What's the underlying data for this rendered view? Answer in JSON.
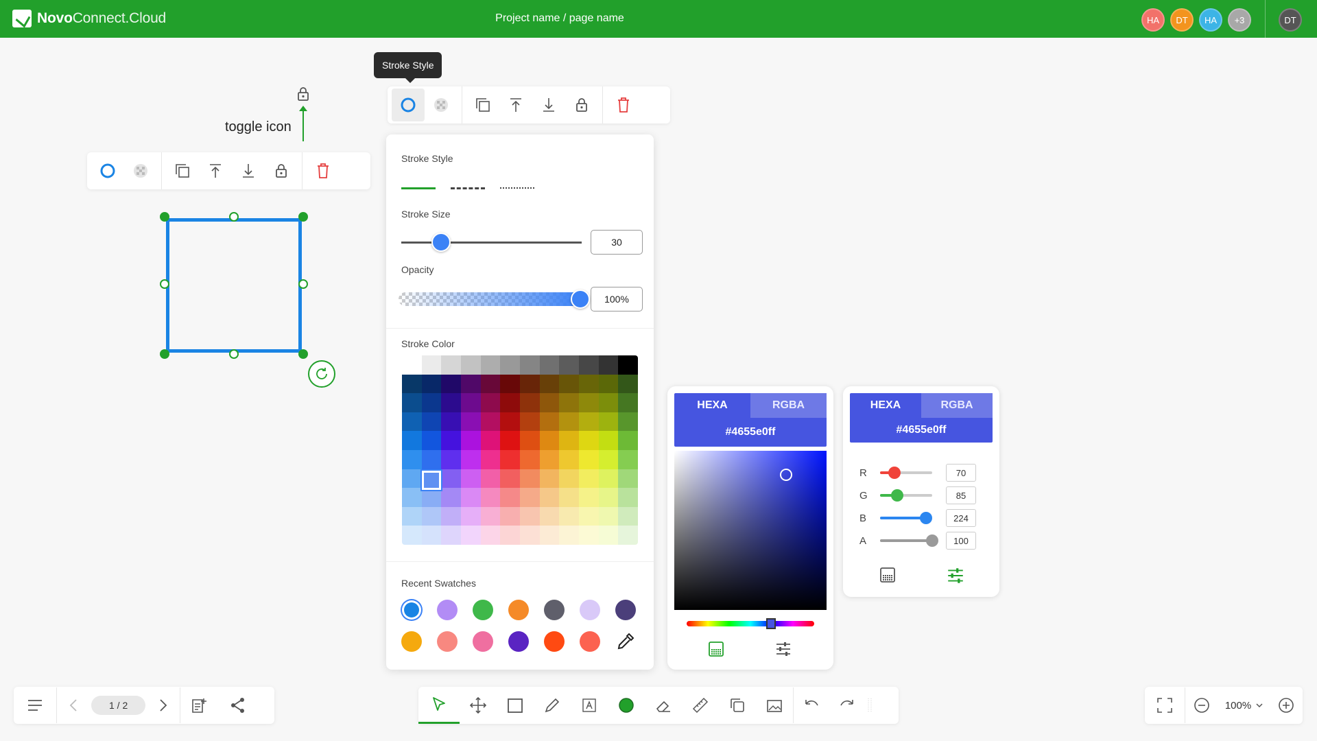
{
  "header": {
    "logo_bold": "Novo",
    "logo_light": "Connect.Cloud",
    "project_title": "Project name / page name",
    "collaborators": [
      {
        "initials": "HA",
        "color": "#f2726a"
      },
      {
        "initials": "DT",
        "color": "#f3941e"
      },
      {
        "initials": "HA",
        "color": "#3cb4e6"
      },
      {
        "initials": "+3",
        "color": "#a8a8a8"
      }
    ],
    "current_user": {
      "initials": "DT",
      "color": "#555555"
    }
  },
  "tooltip": "Stroke Style",
  "annotation": {
    "label": "toggle icon"
  },
  "toolbar_icons": [
    "stroke-style-icon",
    "fill-style-icon",
    "duplicate-icon",
    "bring-to-front-icon",
    "send-to-back-icon",
    "lock-icon",
    "delete-icon"
  ],
  "stroke_panel": {
    "stroke_style_title": "Stroke Style",
    "line_styles": [
      "solid",
      "dashed",
      "dotted"
    ],
    "stroke_size_title": "Stroke Size",
    "stroke_size_value": "30",
    "stroke_size_level": 0.22,
    "opacity_title": "Opacity",
    "opacity_value": "100%",
    "opacity_level": 1.0,
    "stroke_color_title": "Stroke Color",
    "recent_swatches_title": "Recent Swatches",
    "recent_swatches": [
      "#1a84e4",
      "#b28cf5",
      "#3fb84a",
      "#f58a28",
      "#5f5f6b",
      "#d9c9f8",
      "#4b3f7a",
      "#f5a90e",
      "#f88880",
      "#ef6fa0",
      "#5a24c2",
      "#ff4a12",
      "#fc6250"
    ],
    "selected_swatch": "#1a84e4"
  },
  "picker_hsv": {
    "tab_hexa": "HEXA",
    "tab_rgba": "RGBA",
    "hex_value": "#4655e0ff",
    "active_tab": "HEXA"
  },
  "picker_rgba": {
    "tab_hexa": "HEXA",
    "tab_rgba": "RGBA",
    "hex_value": "#4655e0ff",
    "channels": [
      {
        "label": "R",
        "value": "70",
        "color": "#f0433a",
        "level": 0.27
      },
      {
        "label": "G",
        "value": "85",
        "color": "#3fb84a",
        "level": 0.33
      },
      {
        "label": "B",
        "value": "224",
        "color": "#2b86f0",
        "level": 0.88
      },
      {
        "label": "A",
        "value": "100",
        "color": "#9a9a9a",
        "level": 1.0
      }
    ]
  },
  "bottom_left": {
    "page_indicator": "1 / 2"
  },
  "bottom_right": {
    "zoom": "100%"
  },
  "colors": {
    "brand": "#22a02b",
    "accent": "#1a84e4",
    "selection": "#4655e0"
  }
}
